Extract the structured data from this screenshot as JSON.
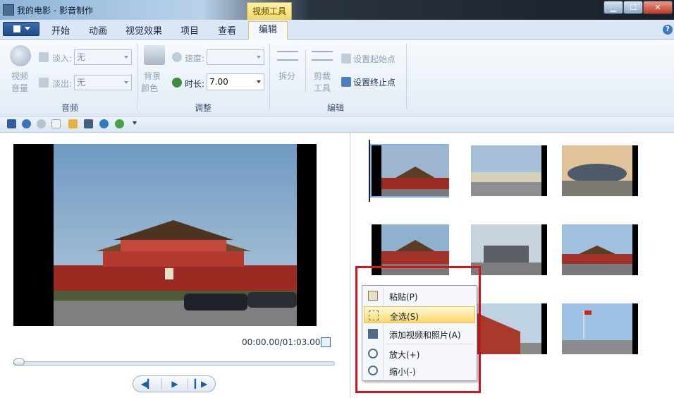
{
  "window": {
    "title": "我的电影 - 影音制作",
    "contextual_tab_group": "视频工具"
  },
  "ribbon_tabs": [
    "开始",
    "动画",
    "视觉效果",
    "项目",
    "查看",
    "编辑"
  ],
  "active_tab": "编辑",
  "ribbon": {
    "audio_group": {
      "label": "音频",
      "volume_label_line1": "视频",
      "volume_label_line2": "音量",
      "fade_in_label": "淡入:",
      "fade_in_value": "无",
      "fade_out_label": "淡出:",
      "fade_out_value": "无"
    },
    "adjust_group": {
      "label": "调整",
      "bg_color_line1": "背景",
      "bg_color_line2": "颜色",
      "speed_label": "速度:",
      "speed_value": "",
      "duration_label": "时长:",
      "duration_value": "7.00"
    },
    "edit_group": {
      "label": "编辑",
      "split_label": "拆分",
      "trim_line1": "剪裁",
      "trim_line2": "工具",
      "set_start": "设置起始点",
      "set_end": "设置终止点"
    }
  },
  "player": {
    "time_readout": "00:00.00/01:03.00",
    "progress_fraction": 0.0
  },
  "context_menu": {
    "items": [
      {
        "label": "粘贴(P)",
        "icon": "paste-icon"
      },
      {
        "label": "全选(S)",
        "icon": "select-all-icon"
      },
      {
        "label": "添加视频和照片(A)",
        "icon": "add-media-icon"
      },
      {
        "label": "放大(+)",
        "icon": "zoom-in-icon"
      },
      {
        "label": "缩小(-)",
        "icon": "zoom-out-icon"
      }
    ],
    "highlighted_index": 1
  },
  "colors": {
    "accent": "#1e4b8a",
    "highlight_border": "#d4141e",
    "menu_hover": "#fbd86d"
  }
}
